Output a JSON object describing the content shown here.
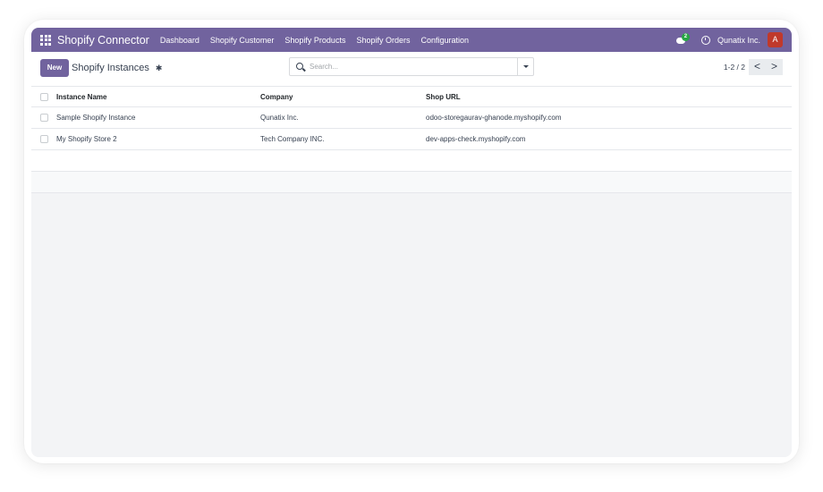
{
  "navbar": {
    "app_title": "Shopify Connector",
    "menu": [
      "Dashboard",
      "Shopify Customer",
      "Shopify Products",
      "Shopify Orders",
      "Configuration"
    ],
    "chat_badge": "2",
    "company": "Qunatix Inc.",
    "avatar_initial": "A",
    "color": "#71639e"
  },
  "control": {
    "new_label": "New",
    "breadcrumb": "Shopify Instances",
    "search_placeholder": "Search...",
    "pager": "1-2 / 2",
    "prev": "<",
    "next": ">"
  },
  "table": {
    "headers": [
      "Instance Name",
      "Company",
      "Shop URL"
    ],
    "rows": [
      {
        "name": "Sample Shopify Instance",
        "company": "Qunatix Inc.",
        "url": "odoo-storegaurav-ghanode.myshopify.com"
      },
      {
        "name": "My Shopify Store 2",
        "company": "Tech Company INC.",
        "url": "dev-apps-check.myshopify.com"
      }
    ]
  },
  "icons": {
    "apps": "apps-grid-icon",
    "chat": "chat-icon",
    "clock": "clock-icon",
    "gear": "gear-icon",
    "search": "search-icon",
    "dropdown": "caret-down-icon"
  }
}
